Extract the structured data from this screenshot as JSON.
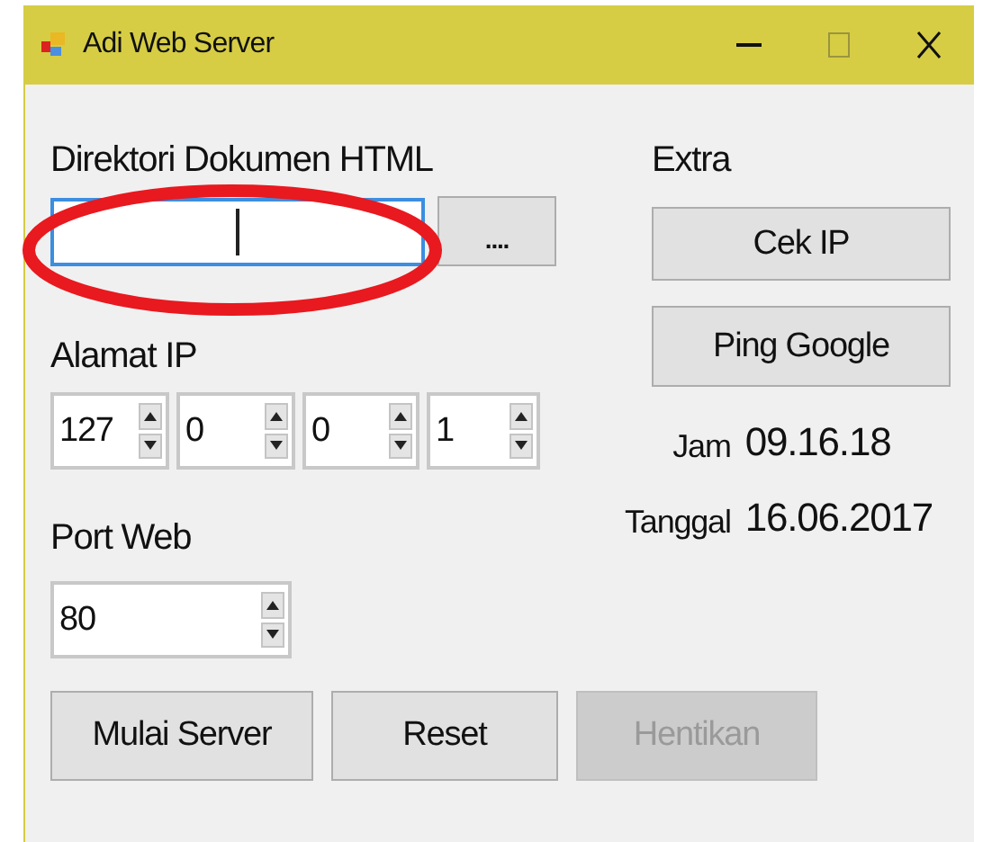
{
  "window": {
    "title": "Adi Web Server"
  },
  "directory": {
    "label": "Direktori Dokumen HTML",
    "focused": true,
    "browse": "...."
  },
  "ip": {
    "label": "Alamat IP",
    "octets": [
      "127",
      "0",
      "0",
      "1"
    ]
  },
  "port": {
    "label": "Port Web",
    "value": "80"
  },
  "buttons": [
    {
      "label": "Mulai Server",
      "disabled": false
    },
    {
      "label": "Reset",
      "disabled": false
    },
    {
      "label": "Hentikan",
      "disabled": true
    }
  ],
  "extra": {
    "label": "Extra",
    "buttons": [
      {
        "label": "Cek IP",
        "disabled": false
      },
      {
        "label": "Ping Google",
        "disabled": false
      }
    ]
  },
  "clock": {
    "time_label": "Jam",
    "time": "09.16.18",
    "date_label": "Tanggal",
    "date": "16.06.2017"
  },
  "annotation": {
    "kind": "ellipse"
  }
}
